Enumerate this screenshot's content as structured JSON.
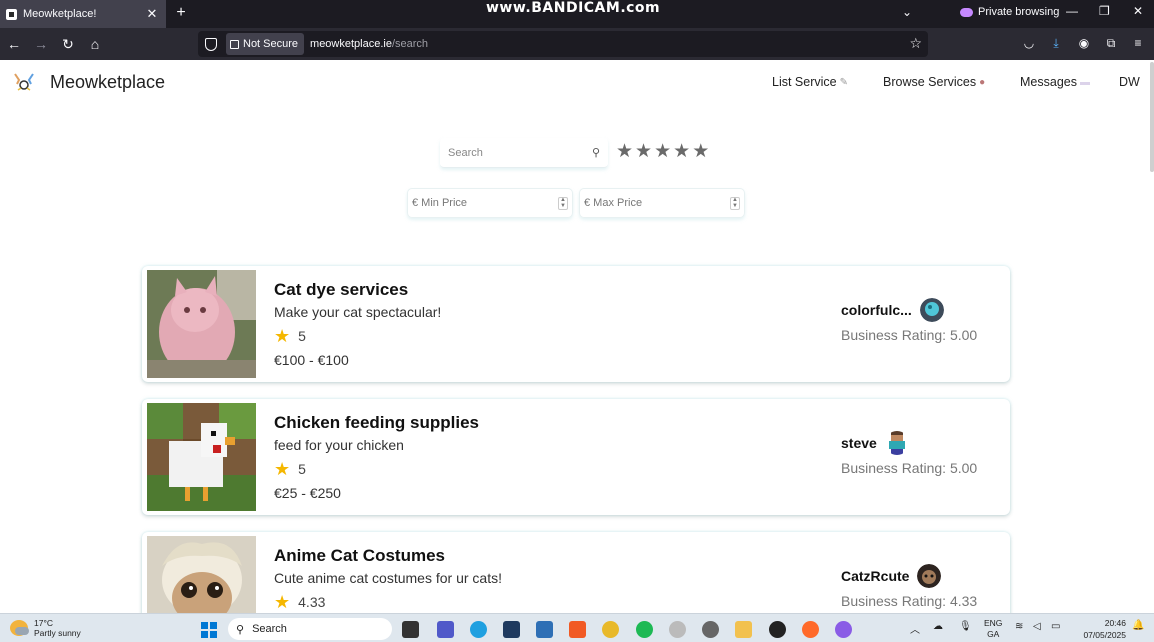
{
  "browser": {
    "tab_title": "Meowketplace!",
    "tab_close": "✕",
    "new_tab": "+",
    "watermark": "www.BANDICAM.com",
    "private_label": "Private browsing",
    "not_secure": "Not Secure",
    "url_host": "meowketplace.ie",
    "url_path": "/search"
  },
  "header": {
    "app_name": "Meowketplace",
    "nav": {
      "list_service": "List Service",
      "browse_services": "Browse Services",
      "messages": "Messages",
      "user_initials": "DW"
    }
  },
  "search": {
    "placeholder": "Search",
    "stars_filter": 5,
    "min_price_placeholder": "€ Min Price",
    "max_price_placeholder": "€ Max Price"
  },
  "listings": [
    {
      "title": "Cat dye services",
      "description": "Make your cat spectacular!",
      "rating": "5",
      "price": "€100 - €100",
      "seller": "colorfulc...",
      "business_rating": "Business Rating: 5.00"
    },
    {
      "title": "Chicken feeding supplies",
      "description": "feed for your chicken",
      "rating": "5",
      "price": "€25 - €250",
      "seller": "steve",
      "business_rating": "Business Rating: 5.00"
    },
    {
      "title": "Anime Cat Costumes",
      "description": "Cute anime cat costumes for ur cats!",
      "rating": "4.33",
      "price": "",
      "seller": "CatzRcute",
      "business_rating": "Business Rating: 4.33"
    }
  ],
  "taskbar": {
    "temperature": "17°C",
    "weather": "Partly sunny",
    "search_label": "Search",
    "lang_top": "ENG",
    "lang_bottom": "GA",
    "time": "20:46",
    "date": "07/05/2025"
  }
}
